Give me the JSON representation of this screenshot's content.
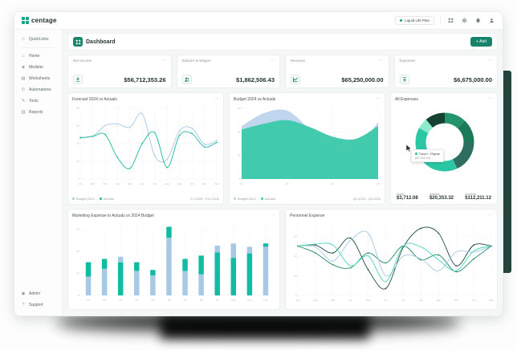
{
  "ui": {
    "card_menu": "⋯",
    "brand_color": "#15846B",
    "logo_green": "#18A183"
  },
  "topbar": {
    "logo": "centage",
    "plan_label": "Liquid Life Plan",
    "icons": [
      "apps",
      "gear",
      "bell",
      "user"
    ]
  },
  "sidebar": {
    "items": [
      {
        "icon": "star",
        "label": "QuickLinks"
      },
      {
        "divider": true
      },
      {
        "icon": "home",
        "label": "Home"
      },
      {
        "icon": "modeler",
        "label": "Modeler"
      },
      {
        "icon": "worksheets",
        "label": "Worksheets"
      },
      {
        "icon": "automations",
        "label": "Automations"
      },
      {
        "icon": "tools",
        "label": "Tools"
      },
      {
        "icon": "reports",
        "label": "Reports"
      }
    ],
    "footer": [
      {
        "icon": "admin",
        "label": "Admin"
      },
      {
        "icon": "support",
        "label": "Support"
      }
    ]
  },
  "page": {
    "title": "Dashboard",
    "add_button": "+ Add"
  },
  "kpis": [
    {
      "label": "Net Income",
      "value": "$56,712,353.26",
      "icon": "download"
    },
    {
      "label": "Salaries & Wages",
      "value": "$1,862,506.43",
      "icon": "users"
    },
    {
      "label": "Revenue",
      "value": "$65,250,000.00",
      "icon": "chartline"
    },
    {
      "label": "Expenses",
      "value": "$6,675,000.00",
      "icon": "upload"
    }
  ],
  "charts": {
    "forecast": {
      "type": "line",
      "title": "Forecast 2024 vs Actuals",
      "x": [
        "Jan",
        "Feb",
        "Mar",
        "Apr",
        "May",
        "Jun",
        "Jul",
        "Aug",
        "Sep",
        "Oct",
        "Nov",
        "Dec"
      ],
      "yticks": [
        0,
        20,
        40,
        60,
        80
      ],
      "ylim": [
        0,
        82
      ],
      "series": [
        {
          "name": "Budget 2024",
          "color": "#A7C9E8",
          "markers": true,
          "values": [
            47,
            48,
            60,
            62,
            58,
            73,
            26,
            22,
            54,
            57,
            39,
            43
          ]
        },
        {
          "name": "Actuals",
          "color": "#19B99F",
          "markers": true,
          "values": [
            46,
            48,
            50,
            24,
            12,
            40,
            52,
            13,
            49,
            51,
            36,
            41
          ]
        }
      ],
      "period": "P1 2025 - P12 2025"
    },
    "budget": {
      "type": "area",
      "title": "Budget 2024 vs Actuals",
      "x": [
        "Q1",
        "Q2",
        "Q3",
        "Q4"
      ],
      "yticks": [
        0,
        20,
        40,
        60
      ],
      "ylim": [
        0,
        62
      ],
      "series": [
        {
          "name": "Budget 2024",
          "color": "#B9D2EC",
          "values": [
            45,
            56,
            58,
            42,
            25,
            27,
            48
          ]
        },
        {
          "name": "Actuals",
          "color": "#3EC9AB",
          "values": [
            42,
            47,
            50,
            44,
            36,
            34,
            45
          ]
        }
      ],
      "period": "Q1 2025 - Q4 2025"
    },
    "donut": {
      "type": "pie",
      "title": "All Expenses",
      "segments": [
        {
          "value": 12,
          "color": "#23956C"
        },
        {
          "value": 13,
          "color": "#1B7A58"
        },
        {
          "value": 18,
          "color": "#2D6E60"
        },
        {
          "value": 40,
          "color": "#2BC7A5"
        },
        {
          "value": 6,
          "color": "#8DEBCD"
        },
        {
          "value": 11,
          "color": "#16402F"
        }
      ],
      "tooltip": {
        "label": "Travel - Flights",
        "value": "($3,280.00)"
      },
      "stats": [
        {
          "label": "Daily",
          "value": "$3,712.08"
        },
        {
          "label": "Weekly",
          "value": "$20,353.32"
        },
        {
          "label": "Monthly",
          "value": "$112,211.12"
        }
      ]
    },
    "marketing": {
      "type": "bar",
      "title": "Marketing Expense in Actuals vs 2024 Budget",
      "x": [
        "P1",
        "P2",
        "P3",
        "P4",
        "P5",
        "P6",
        "P7",
        "P8",
        "P9",
        "P10",
        "P11",
        "P12"
      ],
      "yticks": [
        0,
        20,
        40,
        60
      ],
      "ylim": [
        0,
        66
      ],
      "colors": {
        "blue": "#A7C9E8",
        "teal": "#10BDA3"
      },
      "bars": [
        [
          [
            "blue",
            17
          ],
          [
            "teal",
            13
          ]
        ],
        [
          [
            "blue",
            24
          ],
          [
            "teal",
            9
          ]
        ],
        [
          [
            "teal",
            30
          ],
          [
            "blue",
            5
          ]
        ],
        [
          [
            "blue",
            22
          ],
          [
            "teal",
            8
          ]
        ],
        [
          [
            "blue",
            18
          ],
          [
            "teal",
            5
          ]
        ],
        [
          [
            "blue",
            52
          ],
          [
            "teal",
            10
          ]
        ],
        [
          [
            "blue",
            22
          ],
          [
            "teal",
            11
          ]
        ],
        [
          [
            "blue",
            19
          ],
          [
            "teal",
            17
          ]
        ],
        [
          [
            "teal",
            39
          ],
          [
            "blue",
            6
          ]
        ],
        [
          [
            "teal",
            34
          ],
          [
            "blue",
            13
          ]
        ],
        [
          [
            "teal",
            38
          ],
          [
            "blue",
            6
          ]
        ],
        [
          [
            "blue",
            44
          ],
          [
            "teal",
            3
          ]
        ]
      ]
    },
    "personnel": {
      "type": "line",
      "title": "Personnel Expense",
      "x": [
        "Jan",
        "Feb",
        "Mar",
        "Apr",
        "May",
        "Jun",
        "Jul",
        "Aug",
        "Sep",
        "Oct",
        "Nov",
        "Dec"
      ],
      "yticks": [
        0,
        20,
        40,
        60
      ],
      "ylim": [
        0,
        74
      ],
      "series": [
        {
          "color": "#1E4D3C",
          "markers": true,
          "values": [
            50,
            51,
            43,
            58,
            26,
            7,
            49,
            68,
            63,
            30,
            51,
            50
          ]
        },
        {
          "color": "#1F8A66",
          "markers": true,
          "values": [
            50,
            43,
            31,
            28,
            43,
            33,
            50,
            36,
            41,
            24,
            37,
            50
          ]
        },
        {
          "color": "#A9C8E8",
          "markers": false,
          "values": [
            50,
            49,
            35,
            56,
            63,
            20,
            40,
            37,
            25,
            44,
            44,
            50
          ]
        },
        {
          "color": "#4AD6B6",
          "markers": false,
          "values": [
            50,
            52,
            51,
            30,
            40,
            14,
            50,
            49,
            36,
            25,
            45,
            50
          ]
        }
      ]
    }
  }
}
